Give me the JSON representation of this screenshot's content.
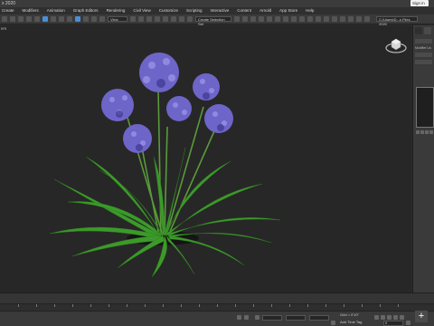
{
  "app": {
    "title": "x 2020",
    "signin_label": "Sign in"
  },
  "menu": [
    "Create",
    "Modifiers",
    "Animation",
    "Graph Editors",
    "Rendering",
    "Civil View",
    "Customize",
    "Scripting",
    "Interactive",
    "Content",
    "Arnold",
    "App Store",
    "Help"
  ],
  "toolbar": {
    "selection_filter": "View",
    "named_selection": "Create Selection Set",
    "workspace": "C:\\Users\\D...s Files 2020"
  },
  "viewport": {
    "label": "ers",
    "background_color": "#272727",
    "plant_color": "#3c9a2a",
    "flower_color": "#6e65c9"
  },
  "right_panel": {
    "label": "Modifier Lis"
  },
  "status": {
    "grid_label": "Grid = 0'10\"",
    "add_time_tag": "Add Time Tag",
    "frame_value": "0"
  }
}
